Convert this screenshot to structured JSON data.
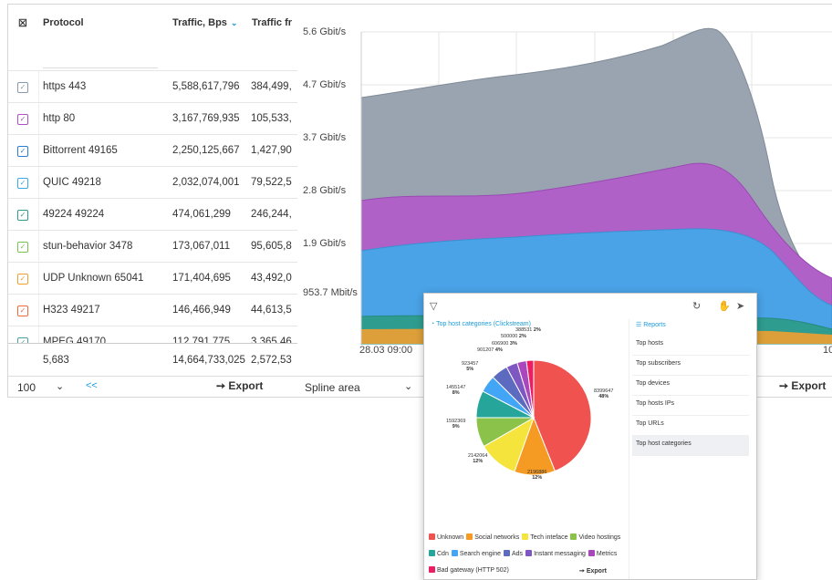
{
  "table": {
    "headers": {
      "protocol": "Protocol",
      "traffic": "Traffic, Bps",
      "traffic_fr": "Traffic fr"
    },
    "rows": [
      {
        "protocol": "https 443",
        "traffic": "5,588,617,796",
        "traffic_fr": "384,499,",
        "color": "#8a9aa9"
      },
      {
        "protocol": "http 80",
        "traffic": "3,167,769,935",
        "traffic_fr": "105,533,",
        "color": "#b04fc4"
      },
      {
        "protocol": "Bittorrent 49165",
        "traffic": "2,250,125,667",
        "traffic_fr": "1,427,90",
        "color": "#2b7fd3"
      },
      {
        "protocol": "QUIC 49218",
        "traffic": "2,032,074,001",
        "traffic_fr": "79,522,5",
        "color": "#3aa9e6"
      },
      {
        "protocol": "49224 49224",
        "traffic": "474,061,299",
        "traffic_fr": "246,244,",
        "color": "#2e9c8f"
      },
      {
        "protocol": "stun-behavior 3478",
        "traffic": "173,067,011",
        "traffic_fr": "95,605,8",
        "color": "#7ac14f"
      },
      {
        "protocol": "UDP Unknown 65041",
        "traffic": "171,404,695",
        "traffic_fr": "43,492,0",
        "color": "#f0a030"
      },
      {
        "protocol": "H323 49217",
        "traffic": "146,466,949",
        "traffic_fr": "44,613,5",
        "color": "#f06a3a"
      },
      {
        "protocol": "MPEG 49170",
        "traffic": "112,791,775",
        "traffic_fr": "3,365,46",
        "color": "#4aa0a0"
      }
    ],
    "totals": {
      "count": "5,683",
      "traffic": "14,664,733,025",
      "traffic_fr": "2,572,53"
    },
    "page_size": "100",
    "first_page": "<<",
    "export": "Export"
  },
  "chart": {
    "chart_data": {
      "type": "area",
      "y_tick_labels": [
        "5.6 Gbit/s",
        "4.7 Gbit/s",
        "3.7 Gbit/s",
        "2.8 Gbit/s",
        "1.9 Gbit/s",
        "953.7 Mbit/s"
      ],
      "x_tick_labels": [
        "28.03 09:00",
        "10"
      ],
      "series_colors": [
        "#9aa4b1",
        "#b061c8",
        "#4aa3e6",
        "#2e9c8f"
      ]
    },
    "type_select": "Spline area",
    "export": "Export"
  },
  "popup": {
    "title": "Top host categories (Clickstream)",
    "reports_title": "Reports",
    "reports": [
      "Top hosts",
      "Top subscribers",
      "Top devices",
      "Top hosts IPs",
      "Top URLs",
      "Top host categories"
    ],
    "active_report": "Top host categories",
    "export": "Export",
    "pie": {
      "chart_data": {
        "type": "pie",
        "slices": [
          {
            "name": "Unknown",
            "value": 8399647,
            "pct": "48%",
            "color": "#f0524f"
          },
          {
            "name": "Social networks",
            "value": 2196886,
            "pct": "12%",
            "color": "#f59a23"
          },
          {
            "name": "Tech inteface",
            "value": 2142064,
            "pct": "12%",
            "color": "#f5e43b"
          },
          {
            "name": "Video hostings",
            "value": 1592369,
            "pct": "9%",
            "color": "#8bc34a"
          },
          {
            "name": "Cdn",
            "value": 1455147,
            "pct": "8%",
            "color": "#26a69a"
          },
          {
            "name": "Search engine",
            "value": 923457,
            "pct": "5%",
            "color": "#42a5f5"
          },
          {
            "name": "Ads",
            "value": 901207,
            "pct": "4%",
            "color": "#5c6bc0"
          },
          {
            "name": "Instant messaging",
            "value": 606900,
            "pct": "3%",
            "color": "#7e57c2"
          },
          {
            "name": "Metrics",
            "value": 500000,
            "pct": "2%",
            "color": "#ab47bc"
          },
          {
            "name": "Bad gateway (HTTP 502)",
            "value": 388531,
            "pct": "2%",
            "color": "#e91e63"
          }
        ]
      }
    },
    "labels": {
      "unknown": "8399647",
      "unknown_pct": "48%",
      "social": "2196886",
      "social_pct": "12%",
      "tech": "2142064",
      "tech_pct": "12%",
      "video": "1592369",
      "video_pct": "9%",
      "cdn": "1455147",
      "cdn_pct": "8%",
      "search": "923457",
      "search_pct": "5%",
      "ads": "901207",
      "ads_pct": "4%",
      "im": "606900",
      "im_pct": "3%",
      "metrics": "500000",
      "metrics_pct": "2%",
      "bad": "388531",
      "bad_pct": "2%"
    }
  }
}
